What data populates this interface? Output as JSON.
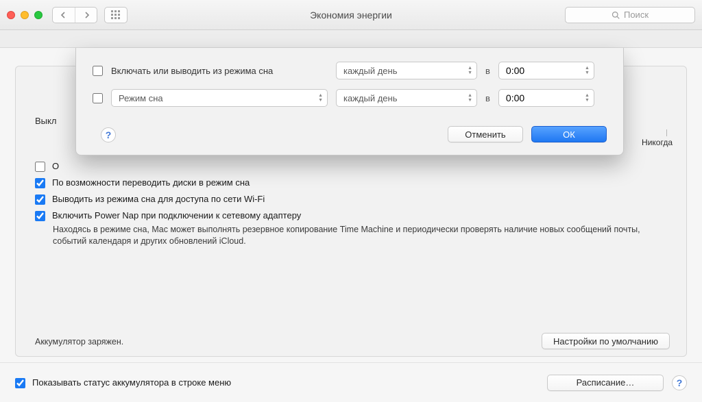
{
  "window": {
    "title": "Экономия энергии"
  },
  "search": {
    "placeholder": "Поиск"
  },
  "slider": {
    "never_label": "Никогда"
  },
  "peek": {
    "turnoff": "Выкл",
    "option_o": "О"
  },
  "checks": {
    "disk_sleep": "По возможности переводить диски в режим сна",
    "wake_wifi": "Выводить из режима сна для доступа по сети Wi-Fi",
    "power_nap": "Включить Power Nap при подключении к сетевому адаптеру",
    "power_nap_desc": "Находясь в режиме сна, Mac может выполнять резервное копирование Time Machine и периодически проверять наличие новых сообщений почты, событий календаря и других обновлений iCloud."
  },
  "battery": {
    "status": "Аккумулятор заряжен."
  },
  "buttons": {
    "defaults": "Настройки по умолчанию",
    "schedule": "Расписание…",
    "cancel": "Отменить",
    "ok": "ОК"
  },
  "bottom": {
    "show_battery_menu": "Показывать статус аккумулятора в строке меню"
  },
  "sheet": {
    "row1_label": "Включать или выводить из режима сна",
    "row2_label": "Режим сна",
    "day1": "каждый день",
    "day2": "каждый день",
    "at": "в",
    "time1": "0:00",
    "time2": "0:00"
  },
  "help": "?"
}
